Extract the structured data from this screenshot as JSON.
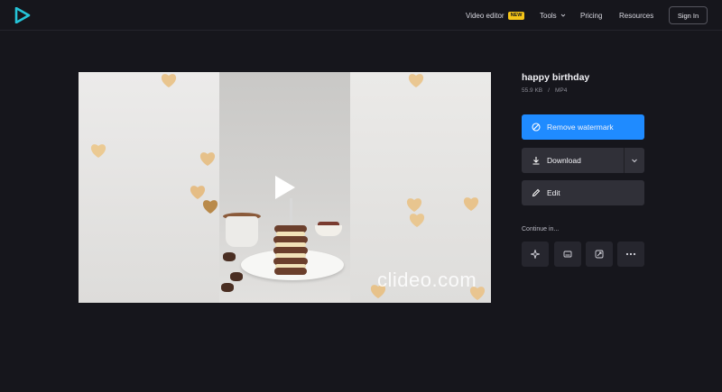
{
  "header": {
    "logo_icon": "clideo-play-logo-icon",
    "nav": {
      "video_editor": "Video editor",
      "new_badge": "NEW",
      "tools": "Tools",
      "pricing": "Pricing",
      "resources": "Resources"
    },
    "sign_in": "Sign In"
  },
  "preview": {
    "watermark": "clideo.com",
    "play_icon": "play-icon"
  },
  "file": {
    "title": "happy birthday",
    "size": "55.9 KB",
    "separator": "/",
    "format": "MP4"
  },
  "actions": {
    "remove_watermark": "Remove watermark",
    "download": "Download",
    "edit": "Edit"
  },
  "continue": {
    "label": "Continue in...",
    "tools": [
      "sparkle-icon",
      "subtitles-icon",
      "resize-icon",
      "more-icon"
    ]
  },
  "colors": {
    "background": "#16161c",
    "accent": "#1f8bff",
    "button_dark": "#303038",
    "badge": "#f5c518"
  }
}
